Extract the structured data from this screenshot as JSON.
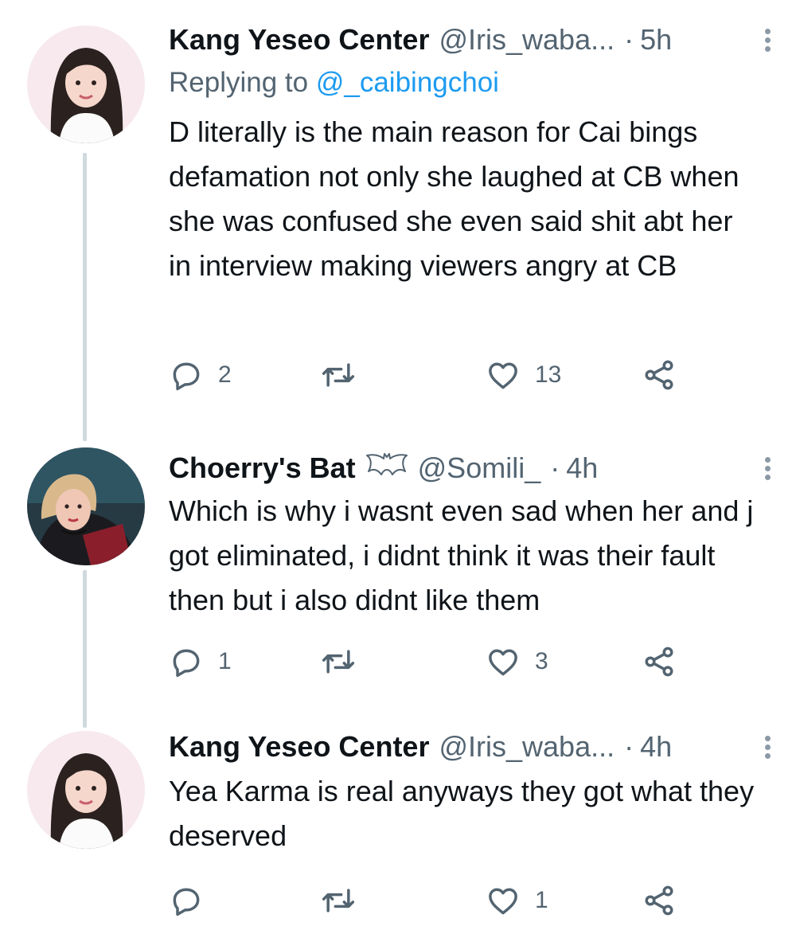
{
  "tweets": [
    {
      "name": "Kang Yeseo Center",
      "handle": "@Iris_waba...",
      "time": "5h",
      "reply_prefix": "Replying to",
      "reply_mention": "@_caibingchoi",
      "text": "D literally is the main reason for Cai bings defamation not only she laughed at CB when she was confused she even said shit abt her in interview making viewers angry at CB",
      "replies": "2",
      "likes": "13"
    },
    {
      "name": "Choerry's Bat",
      "name_badge_icon": "bat-icon",
      "handle": "@Somili_",
      "time": "4h",
      "text": "Which is why i wasnt even sad when her and j got eliminated, i didnt think it was their fault then but i also didnt like them",
      "replies": "1",
      "likes": "3"
    },
    {
      "name": "Kang Yeseo Center",
      "handle": "@Iris_waba...",
      "time": "4h",
      "text": "Yea Karma is real anyways they got what they deserved",
      "replies": "",
      "likes": "1"
    }
  ],
  "icons": {
    "reply": "reply-icon",
    "retweet": "retweet-icon",
    "like": "heart-icon",
    "share": "share-icon",
    "more": "more-options-icon"
  },
  "colors": {
    "text": "#0f1419",
    "secondary": "#536471",
    "link": "#1d9bf0",
    "thread_line": "#cfd9de"
  },
  "dot_separator": "·"
}
